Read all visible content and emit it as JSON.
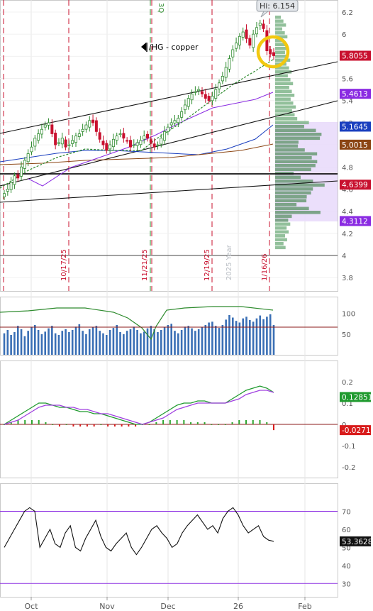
{
  "chart_data": {
    "type": "candlestick",
    "symbol_label": "/HG - copper",
    "hi_label": "Hi: 6.154",
    "x_months": [
      "Oct",
      "Nov",
      "Dec",
      "26",
      "Feb"
    ],
    "event_dates": [
      "10/17/25",
      "11/21/25",
      "12/19/25",
      "1/16/26"
    ],
    "overlay_text": [
      "2025 Year",
      "3Q"
    ],
    "price_axis": {
      "ylim": [
        3.68,
        6.25
      ],
      "ticks": [
        "6.2",
        "6",
        "5.8",
        "5.6",
        "5.4",
        "5.2",
        "5",
        "4.8",
        "4.6",
        "4.4",
        "4.2",
        "4",
        "3.8"
      ]
    },
    "price_tags": [
      {
        "value": "5.8055",
        "price": 5.8055,
        "color": "#c8102e"
      },
      {
        "value": "5.4613",
        "price": 5.4613,
        "color": "#8a2be2"
      },
      {
        "value": "5.1645",
        "price": 5.1645,
        "color": "#1a3fbf"
      },
      {
        "value": "5.0015",
        "price": 5.0015,
        "color": "#8b4513"
      },
      {
        "value": "4.6399",
        "price": 4.6399,
        "color": "#c8102e"
      },
      {
        "value": "4.3112",
        "price": 4.3112,
        "color": "#8a2be2"
      }
    ],
    "closes": [
      4.56,
      4.6,
      4.66,
      4.72,
      4.7,
      4.8,
      4.86,
      4.92,
      4.98,
      5.06,
      5.1,
      5.14,
      5.18,
      5.2,
      5.1,
      5.0,
      5.02,
      5.06,
      4.98,
      5.0,
      5.04,
      5.08,
      5.1,
      5.14,
      5.18,
      5.22,
      5.2,
      5.12,
      5.05,
      5.0,
      4.95,
      5.0,
      5.05,
      5.08,
      5.1,
      5.06,
      5.04,
      4.98,
      5.0,
      5.02,
      5.04,
      5.08,
      5.06,
      5.02,
      4.98,
      5.0,
      5.06,
      5.12,
      5.16,
      5.2,
      5.22,
      5.24,
      5.3,
      5.36,
      5.42,
      5.46,
      5.48,
      5.5,
      5.46,
      5.42,
      5.4,
      5.44,
      5.5,
      5.56,
      5.62,
      5.7,
      5.78,
      5.86,
      5.92,
      5.98,
      6.02,
      5.96,
      5.9,
      6.0,
      6.06,
      6.1,
      6.05,
      5.85,
      5.82,
      5.8055
    ],
    "volume_axis": {
      "ticks": [
        "100",
        "50"
      ]
    },
    "volume": [
      52,
      60,
      48,
      55,
      70,
      62,
      45,
      58,
      66,
      72,
      60,
      50,
      56,
      64,
      70,
      52,
      48,
      58,
      62,
      55,
      60,
      68,
      74,
      58,
      50,
      62,
      66,
      70,
      58,
      52,
      48,
      60,
      65,
      72,
      55,
      50,
      58,
      62,
      68,
      60,
      52,
      56,
      64,
      70,
      62,
      55,
      60,
      66,
      72,
      75,
      58,
      52,
      60,
      68,
      70,
      64,
      58,
      62,
      66,
      72,
      78,
      80,
      70,
      65,
      72,
      85,
      96,
      90,
      82,
      78,
      88,
      92,
      84,
      80,
      88,
      95,
      86,
      92,
      98,
      72
    ],
    "macd_axis": {
      "ticks": [
        "0.2",
        "0.1",
        "0",
        "-0.1",
        "-0.2"
      ]
    },
    "macd_tags": [
      {
        "value": "0.12851",
        "y": 0.1285,
        "color": "#1f9a2e"
      },
      {
        "value": "-0.0271",
        "y": -0.0271,
        "color": "#d81b1b"
      }
    ],
    "macd_line": [
      0.0,
      0.02,
      0.04,
      0.06,
      0.08,
      0.1,
      0.1,
      0.09,
      0.08,
      0.08,
      0.07,
      0.06,
      0.06,
      0.05,
      0.05,
      0.04,
      0.03,
      0.02,
      0.01,
      0.0,
      0.0,
      0.01,
      0.03,
      0.05,
      0.07,
      0.09,
      0.1,
      0.1,
      0.11,
      0.11,
      0.1,
      0.1,
      0.1,
      0.12,
      0.14,
      0.16,
      0.17,
      0.18,
      0.17,
      0.15
    ],
    "macd_signal": [
      0.0,
      0.01,
      0.02,
      0.04,
      0.06,
      0.08,
      0.09,
      0.09,
      0.09,
      0.08,
      0.08,
      0.07,
      0.07,
      0.06,
      0.05,
      0.05,
      0.04,
      0.03,
      0.02,
      0.01,
      0.0,
      0.01,
      0.02,
      0.03,
      0.05,
      0.07,
      0.08,
      0.09,
      0.1,
      0.1,
      0.1,
      0.1,
      0.1,
      0.11,
      0.12,
      0.14,
      0.15,
      0.16,
      0.16,
      0.15
    ],
    "macd_hist": [
      0.0,
      0.01,
      0.02,
      0.02,
      0.02,
      0.02,
      0.01,
      0.0,
      -0.01,
      0.0,
      -0.01,
      -0.01,
      -0.01,
      -0.01,
      0.0,
      -0.01,
      -0.01,
      -0.01,
      -0.01,
      -0.01,
      0.0,
      0.0,
      0.01,
      0.02,
      0.02,
      0.02,
      0.02,
      0.01,
      0.01,
      0.01,
      0.0,
      0.0,
      0.0,
      0.01,
      0.02,
      0.02,
      0.02,
      0.02,
      0.01,
      -0.0271
    ],
    "rsi_axis": {
      "ticks": [
        "70",
        "60",
        "50",
        "40",
        "30"
      ],
      "ylim": [
        25,
        80
      ]
    },
    "rsi_tag": {
      "value": "53.3628",
      "y": 53.36
    },
    "rsi": [
      50,
      55,
      60,
      65,
      70,
      72,
      70,
      50,
      55,
      60,
      52,
      50,
      58,
      62,
      50,
      48,
      55,
      60,
      65,
      56,
      50,
      48,
      52,
      55,
      58,
      50,
      46,
      50,
      55,
      60,
      62,
      58,
      55,
      50,
      52,
      58,
      62,
      65,
      68,
      64,
      60,
      62,
      58,
      66,
      70,
      72,
      68,
      62,
      58,
      60,
      62,
      56,
      54,
      53.36
    ]
  }
}
